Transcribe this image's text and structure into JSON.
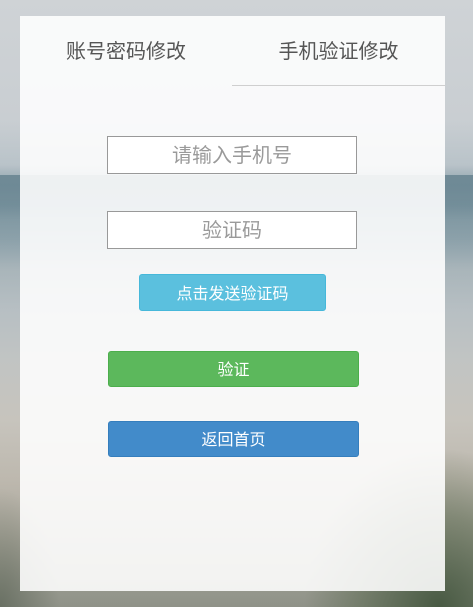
{
  "tabs": {
    "account_password": "账号密码修改",
    "phone_verify": "手机验证修改"
  },
  "form": {
    "phone_placeholder": "请输入手机号",
    "code_placeholder": "验证码",
    "send_code_label": "点击发送验证码",
    "verify_label": "验证",
    "home_label": "返回首页"
  },
  "colors": {
    "send_button": "#5bc0de",
    "verify_button": "#5cb85c",
    "home_button": "#428bca"
  }
}
